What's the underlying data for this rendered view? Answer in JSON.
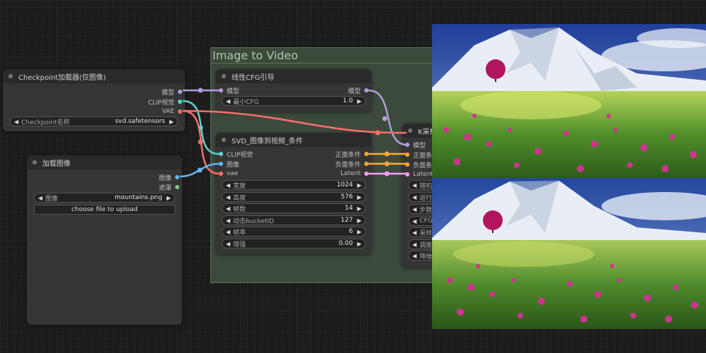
{
  "group": {
    "title": "Image to Video"
  },
  "colors": {
    "model": "#b39ddb",
    "clip_vision": "#5fd3d0",
    "vae": "#ff6e6e",
    "image": "#64b5f6",
    "mask": "#81c784",
    "conditioning": "#ffa931",
    "latent": "#ff9cf9"
  },
  "checkpoint_node": {
    "title": "Checkpoint加载器(仅图像)",
    "outputs": [
      "模型",
      "CLIP视觉",
      "VAE"
    ],
    "widget": {
      "label": "Checkpoint名称",
      "value": "svd.safetensors"
    }
  },
  "load_image_node": {
    "title": "加载图像",
    "outputs": [
      "图像",
      "遮罩"
    ],
    "widget": {
      "label": "图像",
      "value": "mountains.png"
    },
    "upload_label": "choose file to upload"
  },
  "cfg_node": {
    "title": "线性CFG引导",
    "input": "模型",
    "output": "模型",
    "widget": {
      "label": "最小CFG",
      "value": "1.0"
    }
  },
  "svd_node": {
    "title": "SVD_图像到视频_条件",
    "inputs": [
      "CLIP视觉",
      "图像",
      "vae"
    ],
    "outputs": [
      "正面条件",
      "负面条件",
      "Latent"
    ],
    "widgets": [
      {
        "label": "宽度",
        "value": "1024"
      },
      {
        "label": "高度",
        "value": "576"
      },
      {
        "label": "帧数",
        "value": "14"
      },
      {
        "label": "动态bucketID",
        "value": "127"
      },
      {
        "label": "帧率",
        "value": "6"
      },
      {
        "label": "增强",
        "value": "0.00"
      }
    ]
  },
  "ksampler_node": {
    "title": "K采样",
    "inputs": [
      "模型",
      "正面条件",
      "负面条件",
      "Latent"
    ],
    "widgets": [
      "随机",
      "运行",
      "步数",
      "CFG",
      "采样",
      "调度",
      "降噪"
    ]
  }
}
